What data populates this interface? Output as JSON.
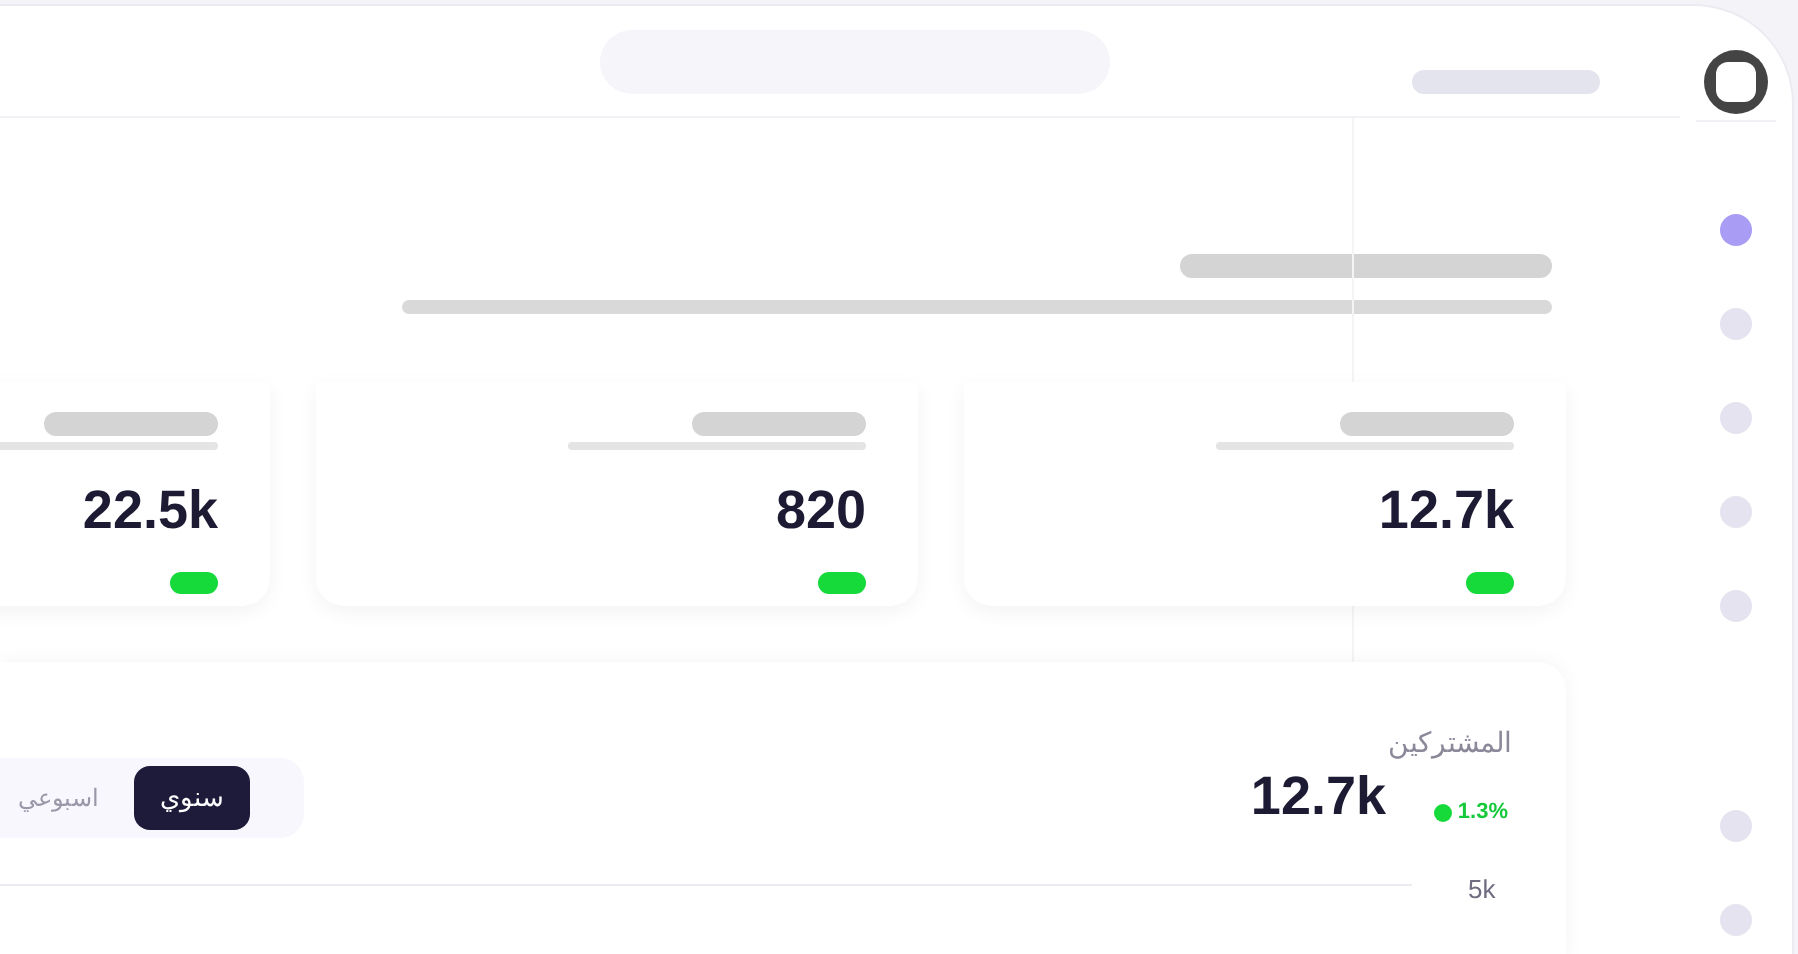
{
  "nav_items": [
    {
      "selected": true
    },
    {
      "selected": false
    },
    {
      "selected": false
    },
    {
      "selected": false
    },
    {
      "selected": false
    },
    {
      "selected": false
    },
    {
      "selected": false
    }
  ],
  "stat_cards": [
    {
      "value": "12.7k"
    },
    {
      "value": "820"
    },
    {
      "value": "22.5k"
    }
  ],
  "subscribers": {
    "title": "المشتركين",
    "value": "12.7k",
    "change": "1.3%",
    "periods": [
      {
        "label": "سنوي",
        "selected": true
      },
      {
        "label": "اسبوعي",
        "selected": false
      }
    ],
    "axis_label": "5k"
  }
}
